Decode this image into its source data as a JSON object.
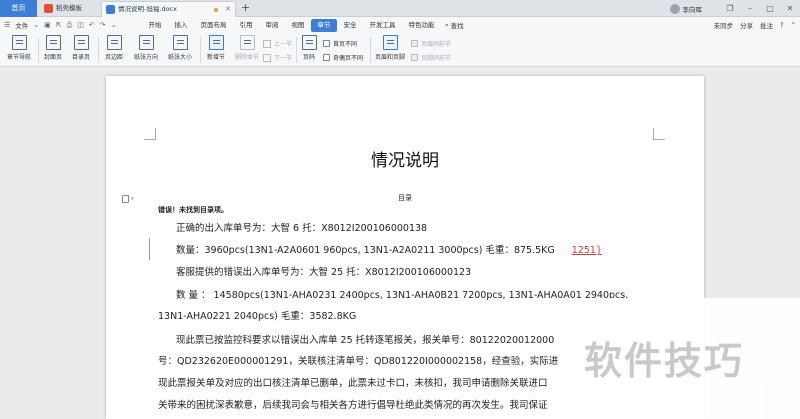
{
  "tabbar": {
    "home": "首页",
    "tabs": [
      {
        "label": "稻壳模板"
      },
      {
        "label": "情况说明-旭福.docx"
      }
    ],
    "add": "+",
    "user": "李向晖"
  },
  "menubar": {
    "file": "文件",
    "tabs": [
      "开始",
      "插入",
      "页面布局",
      "引用",
      "审阅",
      "视图",
      "章节",
      "安全",
      "开发工具",
      "特色功能"
    ],
    "active_tab": "章节",
    "search": "查找",
    "right": {
      "sync": "未同步",
      "share": "分享",
      "comment": "批注"
    }
  },
  "ribbon": {
    "chapter_nav": "章节导航",
    "cover_page": "封面页",
    "toc_page": "目录页",
    "page_border": "页边距",
    "orientation": "纸张方向",
    "paper_size": "纸张大小",
    "new_section": "新增节",
    "delete_section": "删除本节",
    "prev_section": "上一节",
    "next_section": "下一节",
    "page_number": "页码",
    "first_page_diff": "首页不同",
    "odd_even_diff": "奇偶页不同",
    "header_footer": "页眉和页脚",
    "same_as_prev_header": "页眉同前节",
    "same_as_prev_footer": "页脚同前节"
  },
  "document": {
    "title": "情况说明",
    "toc_label": "目录",
    "error": "错误！未找到目录项。",
    "lines": [
      "正确的出入库单号为：大智 6 托：X8012I200106000138",
      "数量：3960pcs(13N1-A2A0601 960pcs, 13N1-A2A0211 3000pcs)    毛重：875.5KG",
      "1251}",
      "客服提供的错误出入库单号为：大智 25 托：X8012I200106000123",
      "数    量  ：   14580pcs(13N1-AHA0231    2400pcs,   13N1-AHA0B21    7200pcs,   13N1-AHA0A01    2940pcs,",
      "13N1-AHA0221 2040pcs)          毛重：3582.8KG",
      "现此票已按监控科要求以错误出入库单 25 托转逐笔报关，报关单号：80122020012000",
      "号：QD232620E000001291，关联核注清单号：QD801220I000002158，经查验，实际进",
      "现此票报关单及对应的出口核注清单已删单，此票未过卡口，未核扣，我司申请删除关联进口",
      "关带来的困扰深表歉意，后续我司会与相关各方进行倡导杜绝此类情况的再次发生。我司保证"
    ]
  },
  "watermark": "软件技巧"
}
